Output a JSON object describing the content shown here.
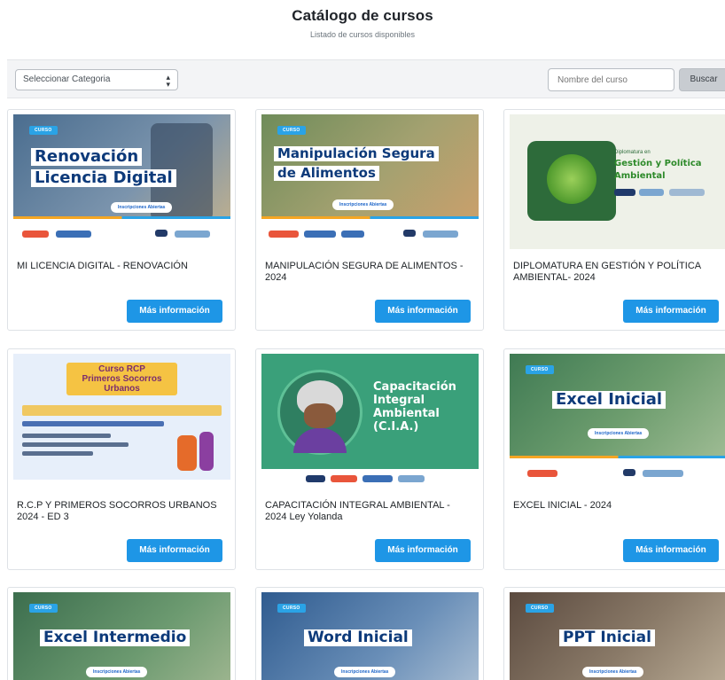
{
  "header": {
    "title": "Catálogo de cursos",
    "subtitle": "Listado de cursos disponibles"
  },
  "filters": {
    "category_label": "Seleccionar Categoria",
    "search_placeholder": "Nombre del curso",
    "search_button": "Buscar"
  },
  "more_info_label": "Más información",
  "thumbnail_badge": "CURSO",
  "thumbnail_insc": "Inscripciones Abiertas",
  "courses": [
    {
      "title": "MI LICENCIA DIGITAL - RENOVACIÓN",
      "thumb_line1": "Renovación",
      "thumb_line2": "Licencia Digital"
    },
    {
      "title": "MANIPULACIÓN SEGURA DE ALIMENTOS - 2024",
      "thumb_line1": "Manipulación Segura",
      "thumb_line2": "de Alimentos"
    },
    {
      "title": "DIPLOMATURA EN GESTIÓN Y POLÍTICA AMBIENTAL- 2024",
      "thumb_small": "Diplomatura en",
      "thumb_line1": "Gestión y Política",
      "thumb_line2": "Ambiental"
    },
    {
      "title": "R.C.P Y PRIMEROS SOCORROS URBANOS 2024 - ED 3",
      "thumb_line1": "Curso RCP",
      "thumb_line2": "Primeros Socorros",
      "thumb_line3": "Urbanos"
    },
    {
      "title": "CAPACITACIÓN INTEGRAL AMBIENTAL - 2024 Ley Yolanda",
      "thumb_line1": "Capacitación",
      "thumb_line2": "Integral",
      "thumb_line3": "Ambiental",
      "thumb_line4": "(C.I.A.)"
    },
    {
      "title": "EXCEL INICIAL - 2024",
      "thumb_line1": "Excel Inicial"
    },
    {
      "thumb_line1": "Excel Intermedio"
    },
    {
      "thumb_line1": "Word Inicial"
    },
    {
      "thumb_line1": "PPT Inicial"
    }
  ],
  "colors": {
    "primary_button": "#1e96e6",
    "thumb_navy": "#0d3a7a",
    "cia_green": "#3aa07a"
  }
}
